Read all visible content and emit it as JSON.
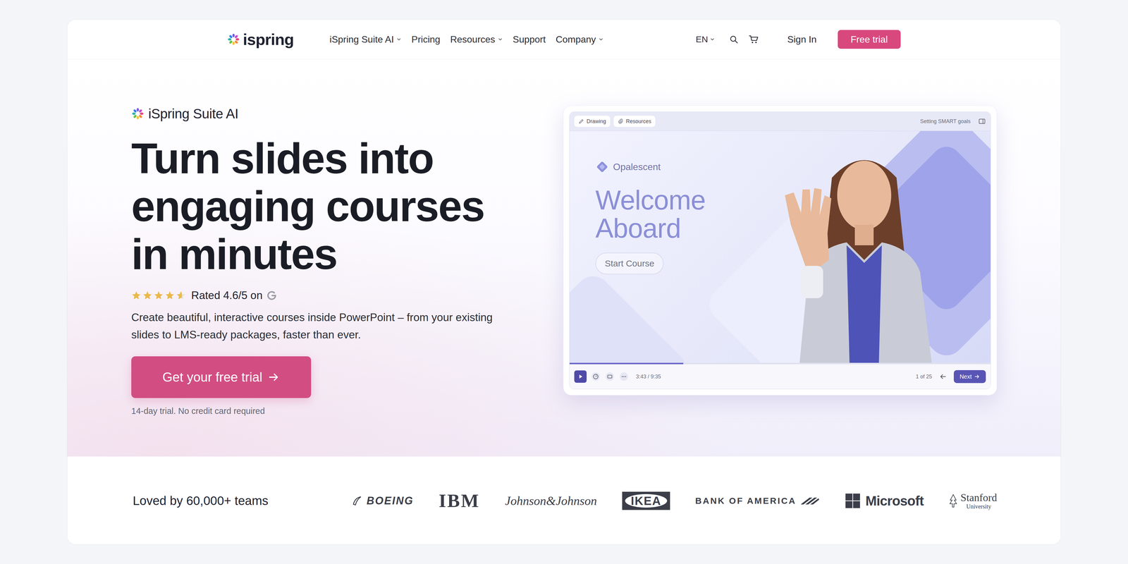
{
  "nav": {
    "logo": "ispring",
    "items": [
      {
        "label": "iSpring Suite AI",
        "has_menu": true
      },
      {
        "label": "Pricing",
        "has_menu": false
      },
      {
        "label": "Resources",
        "has_menu": true
      },
      {
        "label": "Support",
        "has_menu": false
      },
      {
        "label": "Company",
        "has_menu": true
      }
    ],
    "language": "EN",
    "sign_in": "Sign In",
    "cta": "Free trial"
  },
  "hero": {
    "eyebrow": "iSpring Suite AI",
    "title_lines": [
      "Turn slides into",
      "engaging courses",
      "in minutes"
    ],
    "rating": {
      "stars": 4.6,
      "text": "Rated 4.6/5 on"
    },
    "description": "Create beautiful, interactive courses inside PowerPoint – from your existing slides to LMS-ready packages, faster than ever.",
    "cta": "Get your free trial",
    "note": "14-day trial. No credit card required"
  },
  "preview": {
    "toolbar": [
      "Drawing",
      "Resources"
    ],
    "lesson": "Setting SMART goals",
    "brand": "Opalescent",
    "heading_lines": [
      "Welcome",
      "Aboard"
    ],
    "start_button": "Start Course",
    "player": {
      "level": 0.27,
      "time": "3:43 / 9:35",
      "page": "1 of 25",
      "next": "Next"
    }
  },
  "clients": {
    "title": "Loved by 60,000+ teams",
    "logos": [
      {
        "name": "BOEING",
        "kind": "boeing"
      },
      {
        "name": "IBM",
        "kind": "ibm"
      },
      {
        "name": "Johnson&Johnson",
        "kind": "jnj"
      },
      {
        "name": "IKEA",
        "kind": "ikea"
      },
      {
        "name": "BANK OF AMERICA",
        "kind": "boa"
      },
      {
        "name": "Microsoft",
        "kind": "microsoft"
      },
      {
        "name": "Stanford",
        "sub": "University",
        "kind": "stanford"
      }
    ]
  }
}
